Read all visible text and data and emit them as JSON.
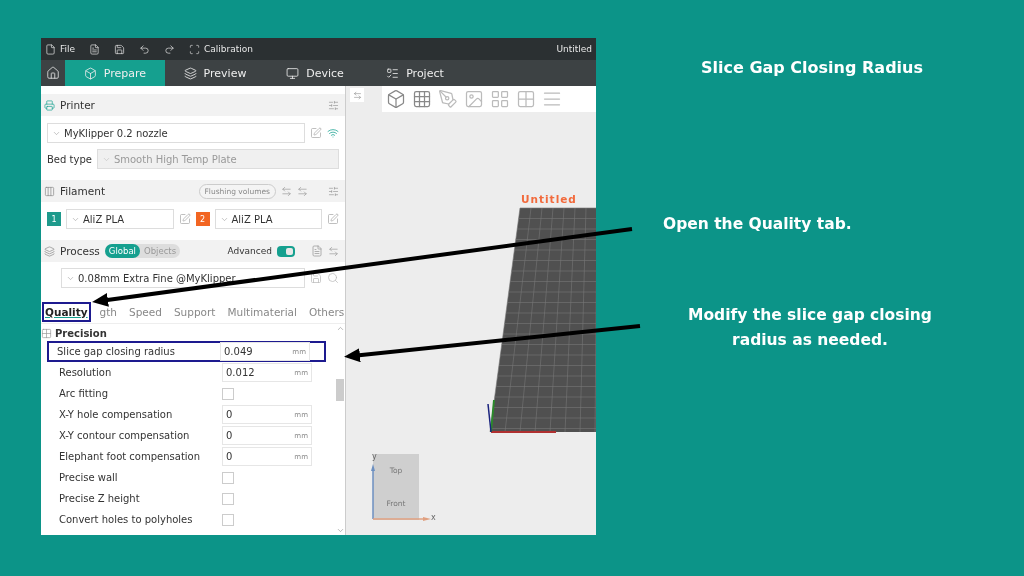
{
  "slide": {
    "title": "Slice Gap Closing Radius",
    "steps": [
      "Open the Quality tab.",
      "Modify the slice gap closing radius as needed."
    ]
  },
  "window": {
    "file_menu": "File",
    "calibration": "Calibration",
    "title": "Untitled"
  },
  "tabs": [
    {
      "label": "Prepare",
      "selected": true
    },
    {
      "label": "Preview",
      "selected": false
    },
    {
      "label": "Device",
      "selected": false
    },
    {
      "label": "Project",
      "selected": false
    }
  ],
  "printer": {
    "header": "Printer",
    "preset": "MyKlipper 0.2 nozzle",
    "bed_label": "Bed type",
    "bed_value": "Smooth High Temp Plate"
  },
  "filament": {
    "header": "Filament",
    "flushing": "Flushing volumes",
    "slots": [
      {
        "number": "1",
        "color": "#1e9a8c",
        "name": "AliZ PLA"
      },
      {
        "number": "2",
        "color": "#f26522",
        "name": "AliZ PLA"
      }
    ]
  },
  "process": {
    "header": "Process",
    "scopes": [
      {
        "label": "Global",
        "selected": true
      },
      {
        "label": "Objects",
        "selected": false
      }
    ],
    "advanced_label": "Advanced",
    "advanced_on": true,
    "preset": "0.08mm Extra Fine @MyKlipper"
  },
  "setting_tabs": [
    {
      "label": "Quality",
      "selected": true,
      "highlighted": true
    },
    {
      "label": "gth",
      "selected": false,
      "highlighted": false
    },
    {
      "label": "Speed",
      "selected": false,
      "highlighted": false
    },
    {
      "label": "Support",
      "selected": false,
      "highlighted": false
    },
    {
      "label": "Multimaterial",
      "selected": false,
      "highlighted": false
    },
    {
      "label": "Others",
      "selected": false,
      "highlighted": false
    }
  ],
  "group": "Precision",
  "settings": [
    {
      "kind": "number",
      "label": "Slice gap closing radius",
      "value": "0.049",
      "unit": "mm",
      "highlighted": true
    },
    {
      "kind": "number",
      "label": "Resolution",
      "value": "0.012",
      "unit": "mm",
      "highlighted": false
    },
    {
      "kind": "checkbox",
      "label": "Arc fitting",
      "checked": false,
      "highlighted": false
    },
    {
      "kind": "number",
      "label": "X-Y hole compensation",
      "value": "0",
      "unit": "mm",
      "highlighted": false
    },
    {
      "kind": "number",
      "label": "X-Y contour compensation",
      "value": "0",
      "unit": "mm",
      "highlighted": false
    },
    {
      "kind": "number",
      "label": "Elephant foot compensation",
      "value": "0",
      "unit": "mm",
      "highlighted": false
    },
    {
      "kind": "checkbox",
      "label": "Precise wall",
      "checked": false,
      "highlighted": false
    },
    {
      "kind": "checkbox",
      "label": "Precise Z height",
      "checked": false,
      "highlighted": false
    },
    {
      "kind": "checkbox",
      "label": "Convert holes to polyholes",
      "checked": false,
      "highlighted": false
    }
  ],
  "viewport": {
    "plate_label": "Untitled",
    "cube_top": "Top",
    "cube_front": "Front",
    "axis_x": "x",
    "axis_y": "y"
  }
}
